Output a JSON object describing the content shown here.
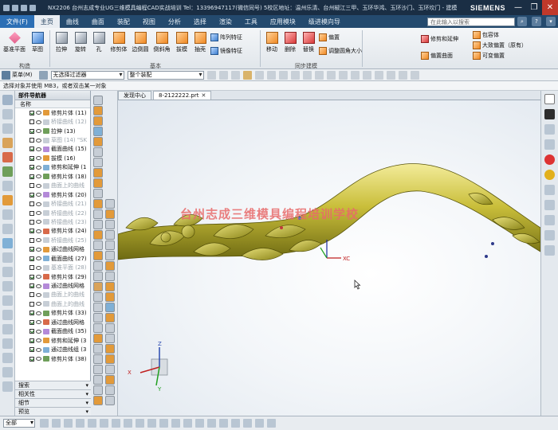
{
  "titlebar": {
    "title": "NX2206 台州志成专业UG三维模具编程CAD实战培训 Tel：13396947117(微信同号)  5校区地址：温州乐清、台州椒江三甲、玉环华鸿、玉环沙门、玉环坎门 - 建模",
    "brand": "SIEMENS",
    "win_min": "—",
    "win_max": "❐",
    "win_close": "✕"
  },
  "menubar": {
    "file_label": "文件(F)",
    "tabs": [
      "主页",
      "曲线",
      "曲面",
      "装配",
      "视图",
      "分析",
      "选择",
      "渲染",
      "工具",
      "应用模块",
      "级进模向导"
    ],
    "active_tab": "主页",
    "search_placeholder": "在此输入以搜索",
    "help_glyph": "?"
  },
  "ribbon": {
    "group1": {
      "label": "构造",
      "buttons": [
        "基准平面",
        "草图"
      ]
    },
    "group2": {
      "label": "基本",
      "buttons": [
        "拉伸",
        "旋转",
        "孔",
        "修剪体",
        "边倒圆",
        "倒斜角",
        "拔模",
        "抽壳"
      ],
      "small": [
        "阵列特征",
        "镜像特征"
      ]
    },
    "group3": {
      "label": "同步建模",
      "buttons": [
        "移动",
        "删除",
        "替换"
      ],
      "small": [
        "偏置",
        "调整圆角大小"
      ]
    },
    "group4": {
      "small": [
        "修剪和延伸",
        "偏置曲面",
        "包容体",
        "大致偏置（原有）",
        "可变偏置"
      ]
    }
  },
  "selbar": {
    "menu_label": "菜单(M)",
    "filter_value": "无选择过滤器",
    "scope_value": "整个装配"
  },
  "status_message": "选择对象并使用 MB3，或者双击某一对象",
  "navigator": {
    "title": "部件导航器",
    "column": "名称",
    "rows": [
      {
        "label": "修剪片体 (11)",
        "dim": false
      },
      {
        "label": "桥接曲线 (12)",
        "dim": true
      },
      {
        "label": "拉伸 (13)",
        "dim": false
      },
      {
        "label": "草图 (14) \"SK",
        "dim": true
      },
      {
        "label": "截面曲线 (15)",
        "dim": false
      },
      {
        "label": "拔模 (16)",
        "dim": false
      },
      {
        "label": "修剪和延伸 (1",
        "dim": false
      },
      {
        "label": "修剪片体 (18)",
        "dim": false
      },
      {
        "label": "曲面上的曲线",
        "dim": true
      },
      {
        "label": "修剪片体 (20)",
        "dim": false
      },
      {
        "label": "桥接曲线 (21)",
        "dim": true
      },
      {
        "label": "桥接曲线 (22)",
        "dim": true
      },
      {
        "label": "桥接曲线 (23)",
        "dim": true
      },
      {
        "label": "修剪片体 (24)",
        "dim": false
      },
      {
        "label": "桥接曲线 (25)",
        "dim": true
      },
      {
        "label": "通过曲线网格",
        "dim": false
      },
      {
        "label": "截面曲线 (27)",
        "dim": false
      },
      {
        "label": "基准平面 (28)",
        "dim": true
      },
      {
        "label": "修剪片体 (29)",
        "dim": false
      },
      {
        "label": "通过曲线网格",
        "dim": false
      },
      {
        "label": "曲面上的曲线",
        "dim": true
      },
      {
        "label": "曲面上的曲线",
        "dim": true
      },
      {
        "label": "修剪片体 (33)",
        "dim": false
      },
      {
        "label": "通过曲线网格",
        "dim": false
      },
      {
        "label": "截面曲线 (35)",
        "dim": false
      },
      {
        "label": "修剪和延伸 (3",
        "dim": false
      },
      {
        "label": "通过曲线组 (3",
        "dim": false
      },
      {
        "label": "修剪片体 (38)",
        "dim": false
      }
    ],
    "panels": [
      "搜索",
      "相关性",
      "细节",
      "预览"
    ]
  },
  "doc_tabs": [
    {
      "label": "发现中心",
      "active": false
    },
    {
      "label": "8-2122222.prt",
      "active": true,
      "close": "✕"
    }
  ],
  "viewport": {
    "watermark": "台州志成三维模具编程培训学校",
    "axis_x": "XC",
    "triad_x": "X",
    "triad_y": "Y",
    "triad_z": "Z"
  },
  "bottombar": {
    "filter_value": "全部"
  }
}
